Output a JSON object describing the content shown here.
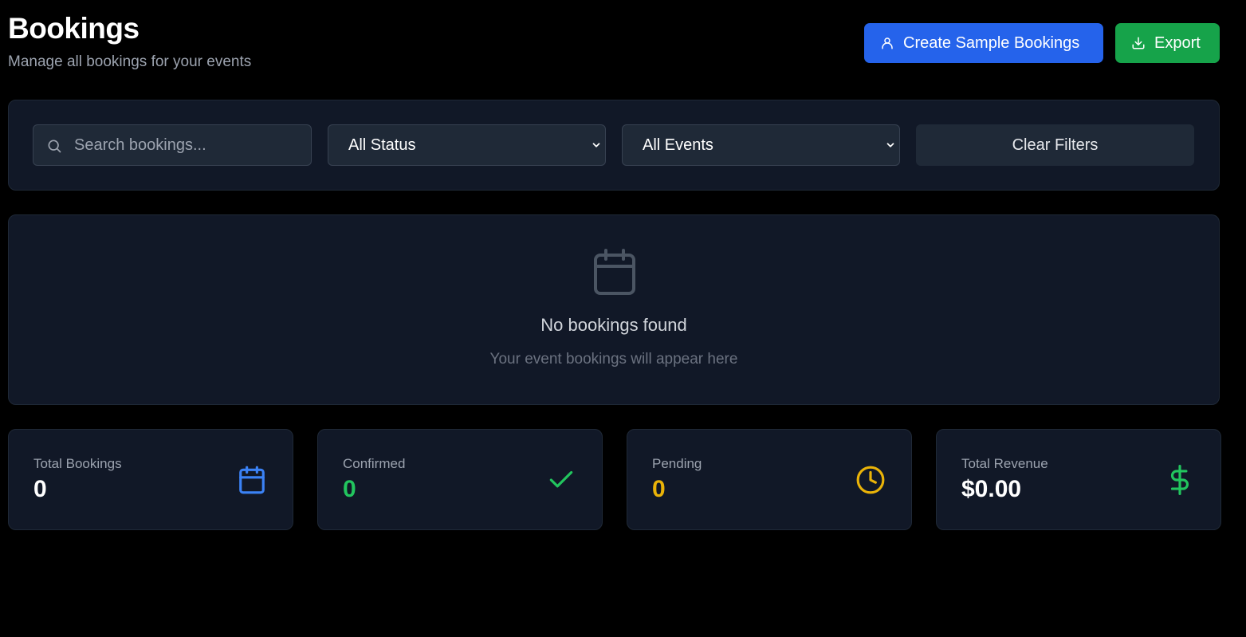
{
  "header": {
    "title": "Bookings",
    "subtitle": "Manage all bookings for your events"
  },
  "actions": {
    "create_label": "Create Sample Bookings",
    "export_label": "Export"
  },
  "filters": {
    "search_placeholder": "Search bookings...",
    "status_selected": "All Status",
    "event_selected": "All Events",
    "clear_label": "Clear Filters"
  },
  "empty_state": {
    "icon": "calendar-icon",
    "title": "No bookings found",
    "description": "Your event bookings will appear here"
  },
  "stats": [
    {
      "label": "Total Bookings",
      "value": "0",
      "icon": "calendar-icon",
      "color": "#3b82f6",
      "value_color": "#ffffff"
    },
    {
      "label": "Confirmed",
      "value": "0",
      "icon": "check-icon",
      "color": "#22c55e",
      "value_color": "#22c55e"
    },
    {
      "label": "Pending",
      "value": "0",
      "icon": "clock-icon",
      "color": "#eab308",
      "value_color": "#eab308"
    },
    {
      "label": "Total Revenue",
      "value": "$0.00",
      "icon": "dollar-icon",
      "color": "#22c55e",
      "value_color": "#ffffff"
    }
  ],
  "colors": {
    "background": "#000000",
    "panel": "#111827",
    "primary": "#2563eb",
    "success": "#16a34a"
  }
}
